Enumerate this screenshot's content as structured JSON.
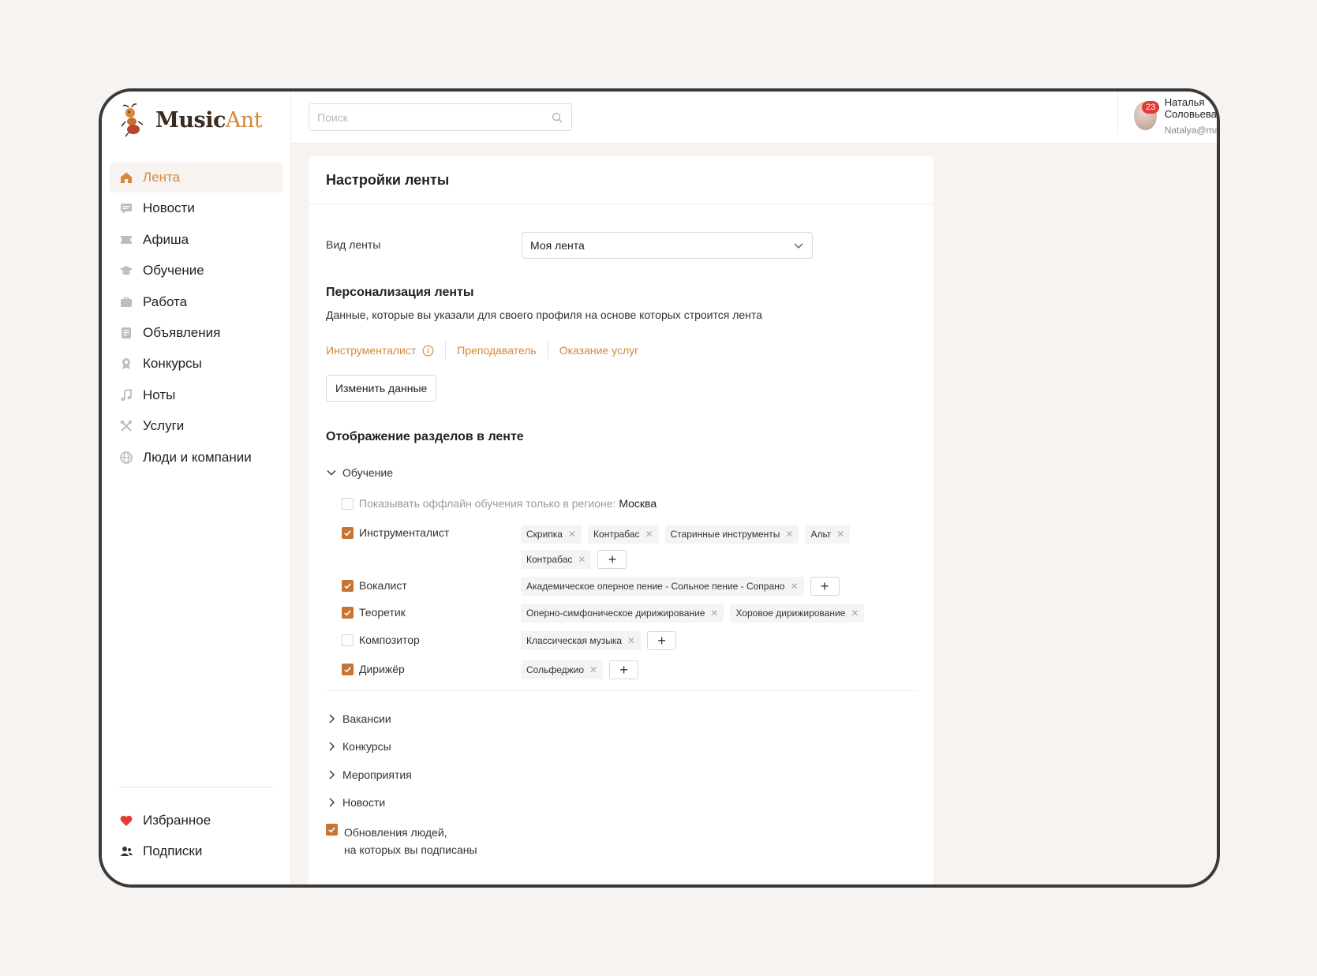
{
  "brand": {
    "name_main": "Music",
    "name_accent": "Ant"
  },
  "search": {
    "placeholder": "Поиск"
  },
  "user": {
    "name": "Наталья Соловьева",
    "email": "Natalya@mail.ru",
    "notifications": "23"
  },
  "sidebar": {
    "items": [
      {
        "label": "Лента",
        "icon": "home-icon",
        "active": true
      },
      {
        "label": "Новости",
        "icon": "news-icon"
      },
      {
        "label": "Афиша",
        "icon": "ticket-icon"
      },
      {
        "label": "Обучение",
        "icon": "graduation-cap-icon"
      },
      {
        "label": "Работа",
        "icon": "briefcase-icon"
      },
      {
        "label": "Объявления",
        "icon": "document-icon"
      },
      {
        "label": "Конкурсы",
        "icon": "award-icon"
      },
      {
        "label": "Ноты",
        "icon": "music-note-icon"
      },
      {
        "label": "Услуги",
        "icon": "tools-icon"
      },
      {
        "label": "Люди и компании",
        "icon": "globe-icon"
      }
    ],
    "bottom": [
      {
        "label": "Избранное",
        "icon": "heart-icon"
      },
      {
        "label": "Подписки",
        "icon": "users-icon"
      }
    ]
  },
  "settings": {
    "title": "Настройки ленты",
    "feed_type_label": "Вид ленты",
    "feed_type_value": "Моя лента",
    "personalization_title": "Персонализация ленты",
    "personalization_desc": "Данные, которые вы указали для своего профиля на основе которых строится лента",
    "roles": [
      "Инструменталист",
      "Преподаватель",
      "Оказание услуг"
    ],
    "change_button": "Изменить данные",
    "sections_title": "Отображение разделов в ленте",
    "education": {
      "title": "Обучение",
      "offline_label": "Показывать оффлайн обучения только в регионе:",
      "offline_region": "Москва",
      "rows": [
        {
          "label": "Инструменталист",
          "checked": true,
          "tags": [
            "Скрипка",
            "Контрабас",
            "Старинные инструменты",
            "Альт",
            "Контрабас"
          ],
          "add": true
        },
        {
          "label": "Вокалист",
          "checked": true,
          "tags": [
            "Академическое оперное пение - Сольное пение - Сопрано"
          ],
          "add": true
        },
        {
          "label": "Теоретик",
          "checked": true,
          "tags": [
            "Оперно-симфоническое дирижирование",
            "Хоровое дирижирование"
          ],
          "add": false
        },
        {
          "label": "Композитор",
          "checked": false,
          "tags": [
            "Классическая музыка"
          ],
          "add": true
        },
        {
          "label": "Дирижёр",
          "checked": true,
          "tags": [
            "Сольфеджио"
          ],
          "add": true
        }
      ]
    },
    "collapsed_sections": [
      "Вакансии",
      "Конкурсы",
      "Мероприятия",
      "Новости"
    ],
    "people_updates": {
      "line1": "Обновления людей,",
      "line2": "на которых вы подписаны",
      "checked": true
    }
  },
  "colors": {
    "accent": "#d4893c",
    "checkbox": "#c87432",
    "badge": "#e53935"
  }
}
